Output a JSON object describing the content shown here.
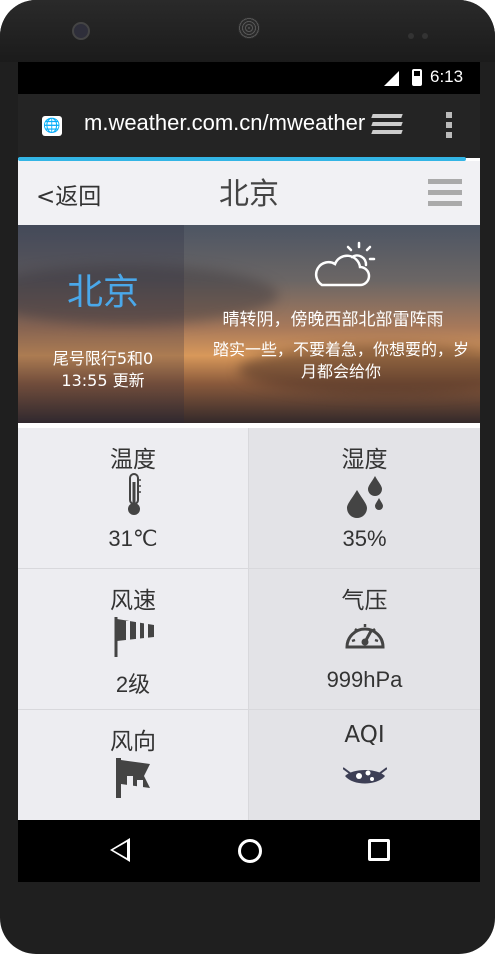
{
  "status_bar": {
    "time": "6:13"
  },
  "browser": {
    "url": "m.weather.com.cn/mweather",
    "favicon": "globe-icon",
    "accent": "#33b5e5"
  },
  "nav": {
    "back_label": "<返回",
    "title": "北京",
    "menu_icon": "hamburger-menu-icon"
  },
  "hero": {
    "city": "北京",
    "city_color": "#4aa8ea",
    "limit": "尾号限行5和0",
    "updated": "13:55 更新",
    "condition": "晴转阴，傍晚西部北部雷阵雨",
    "quote": "踏实一些，不要着急，你想要的，岁月都会给你",
    "weather_icon": "cloud-sun-icon"
  },
  "metrics": [
    {
      "label": "温度",
      "value": "31℃",
      "icon": "thermometer-icon"
    },
    {
      "label": "湿度",
      "value": "35%",
      "icon": "water-drops-icon"
    },
    {
      "label": "风速",
      "value": "2级",
      "icon": "windsock-icon"
    },
    {
      "label": "气压",
      "value": "999hPa",
      "icon": "gauge-icon"
    },
    {
      "label": "风向",
      "value": "",
      "icon": "wind-flag-icon"
    },
    {
      "label": "AQI",
      "value": "",
      "icon": "aqi-mask-icon"
    }
  ]
}
